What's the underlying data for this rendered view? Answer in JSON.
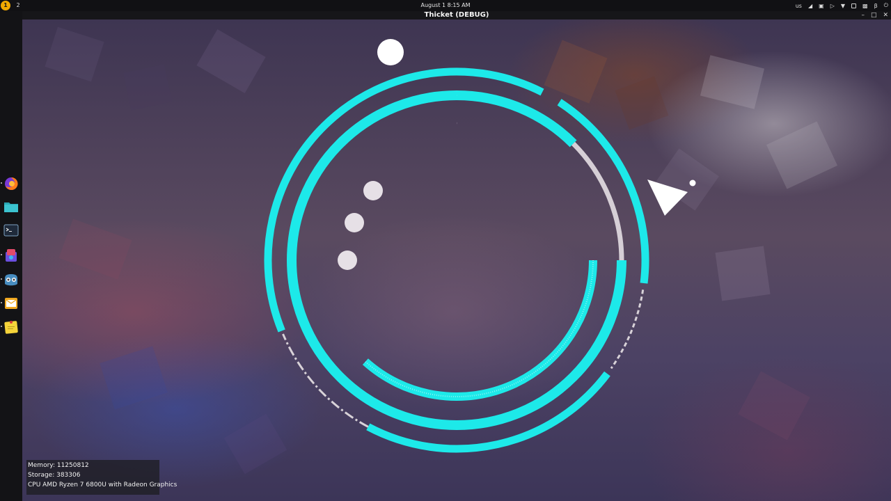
{
  "topbar": {
    "workspaces": [
      "1",
      "2"
    ],
    "clock": "August 1  8:15 AM",
    "keyboard_layout": "us",
    "tray_icons": [
      "signal-icon",
      "network-icon",
      "volume-icon",
      "wifi-icon",
      "battery-icon",
      "chat-icon",
      "bluetooth-icon",
      "power-icon"
    ]
  },
  "window": {
    "title": "Thicket (DEBUG)",
    "controls": [
      "minimize-icon",
      "maximize-icon",
      "close-icon"
    ]
  },
  "dock": {
    "apps": [
      "firefox-icon",
      "files-icon",
      "terminal-icon",
      "software-store-icon",
      "godot-icon",
      "mail-icon",
      "sticky-notes-icon"
    ]
  },
  "game": {
    "accent_color": "#1de9e9",
    "debug": {
      "memory": "Memory: 11250812",
      "storage": "Storage: 383306",
      "cpu": "CPU AMD Ryzen 7 6800U with Radeon Graphics"
    }
  }
}
